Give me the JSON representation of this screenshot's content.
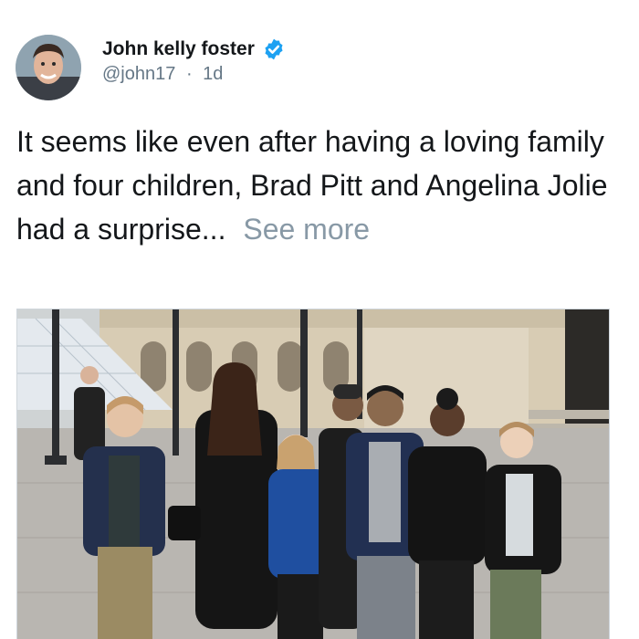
{
  "tweet": {
    "display_name": "John kelly foster",
    "handle": "@john17",
    "separator": "·",
    "time": "1d",
    "text": "It seems like even after having a loving family and four children, Brad Pitt and Angelina Jolie had a surprise...",
    "see_more": "See more"
  },
  "colors": {
    "verified": "#1da1f2",
    "muted_text": "#657786",
    "see_more": "#8899a6",
    "body_text": "#14171a"
  },
  "icons": {
    "verified": "verified-badge-icon"
  }
}
